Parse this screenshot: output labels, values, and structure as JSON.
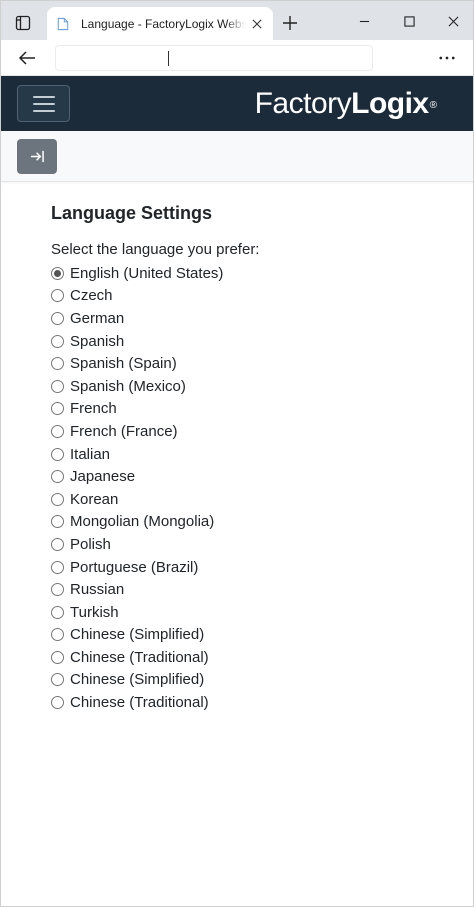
{
  "browser": {
    "tab_title": "Language - FactoryLogix Website",
    "address_value": ""
  },
  "header": {
    "brand_light": "Factory",
    "brand_bold": "Logix",
    "brand_mark": "®",
    "bg_color": "#1c2b3a"
  },
  "page": {
    "title": "Language Settings",
    "prompt": "Select the language you prefer:",
    "selected_index": 0,
    "languages": [
      "English (United States)",
      "Czech",
      "German",
      "Spanish",
      "Spanish (Spain)",
      "Spanish (Mexico)",
      "French",
      "French (France)",
      "Italian",
      "Japanese",
      "Korean",
      "Mongolian (Mongolia)",
      "Polish",
      "Portuguese (Brazil)",
      "Russian",
      "Turkish",
      "Chinese (Simplified)",
      "Chinese (Traditional)",
      "Chinese (Simplified)",
      "Chinese (Traditional)"
    ]
  },
  "icons": {
    "tab_actions": "tab-actions-icon",
    "favicon": "page-icon",
    "close": "close-icon",
    "new_tab": "plus-icon",
    "minimize": "minimize-icon",
    "maximize": "maximize-icon",
    "window_close": "close-icon",
    "back": "back-arrow-icon",
    "more": "more-icon",
    "menu": "hamburger-icon",
    "expand": "expand-sidebar-icon"
  }
}
